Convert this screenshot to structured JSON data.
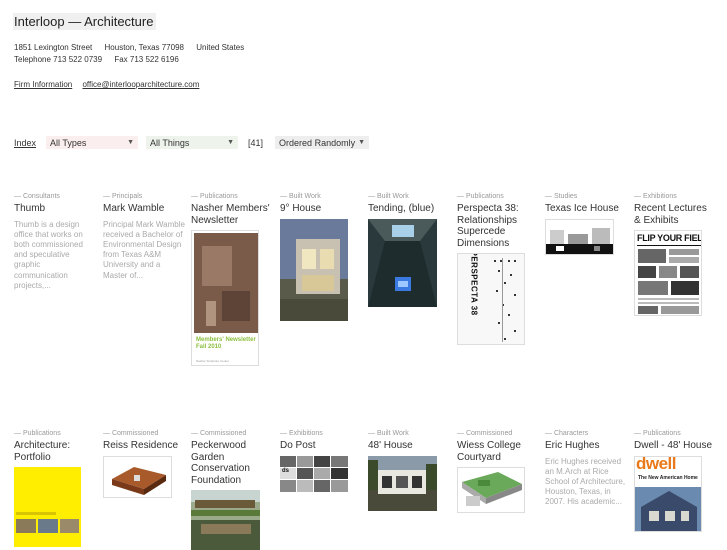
{
  "header": {
    "title": "Interloop — Architecture",
    "address": [
      "1851 Lexington Street",
      "Houston, Texas 77098",
      "United States"
    ],
    "contact": [
      "Telephone 713 522 0739",
      "Fax 713 522 6196"
    ],
    "links": [
      "Firm Information",
      "office@interlooparchitecture.com"
    ]
  },
  "filters": {
    "index_label": "Index",
    "types": "All Types",
    "things": "All Things",
    "count": "[41]",
    "order": "Ordered Randomly",
    "arrow": "▼"
  },
  "colors": {
    "types_bg": "#fbeeee",
    "things_bg": "#eef3ec",
    "order_bg": "#eeeeee",
    "yellow": "#ffee00",
    "dwell_orange": "#e9791a"
  },
  "items": [
    {
      "category": "— Consultants",
      "title": "Thumb",
      "desc": "Thumb is a design office that works on both commissioned and speculative graphic communication projects,..."
    },
    {
      "category": "— Principals",
      "title": "Mark Wamble",
      "desc": "Principal Mark Wamble received a Bachelor of Environmental Design from Texas A&M University and a Master of..."
    },
    {
      "category": "— Publications",
      "title": "Nasher Members' Newsletter",
      "cover_text": "Members' Newsletter Fall 2010",
      "cover_sub": "Nasher Sculpture Center"
    },
    {
      "category": "— Built Work",
      "title": "9° House"
    },
    {
      "category": "— Built Work",
      "title": "Tending, (blue)"
    },
    {
      "category": "— Publications",
      "title": "Perspecta 38: Relationships Supercede Dimensions",
      "cover_text": "PERSPECTA 38"
    },
    {
      "category": "— Studies",
      "title": "Texas Ice House"
    },
    {
      "category": "— Exhibitions",
      "title": "Recent Lectures & Exhibits",
      "cover_text": "FLIP YOUR FIELD"
    },
    {
      "category": "— Publications",
      "title": "Architecture: Portfolio"
    },
    {
      "category": "— Commissioned",
      "title": "Reiss Residence"
    },
    {
      "category": "— Commissioned",
      "title": "Peckerwood Garden Conservation Foundation"
    },
    {
      "category": "— Exhibitions",
      "title": "Do Post",
      "cover_text": "ds"
    },
    {
      "category": "— Built Work",
      "title": "48' House"
    },
    {
      "category": "— Commissioned",
      "title": "Wiess College Courtyard"
    },
    {
      "category": "— Characters",
      "title": "Eric Hughes",
      "desc": "Eric Hughes received an M.Arch at Rice School of Architecture, Houston, Texas, in 2007. His academic..."
    },
    {
      "category": "— Publications",
      "title": "Dwell - 48' House",
      "cover_text": "dwell",
      "cover_sub": "The New American Home"
    }
  ]
}
